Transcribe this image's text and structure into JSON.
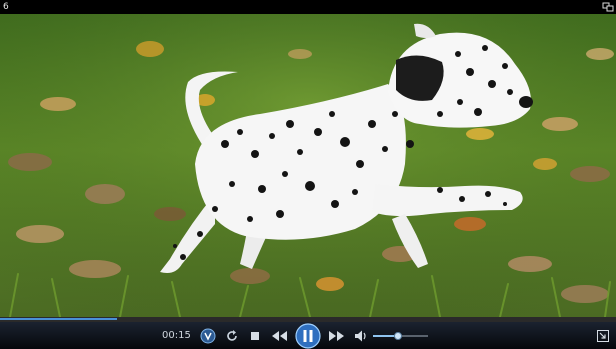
{
  "window": {
    "title": "6"
  },
  "playback": {
    "time_display": "00:15",
    "progress_fraction": 0.19,
    "volume_fraction": 0.45,
    "state": "playing"
  },
  "icons": {
    "restore": "restore-window-icon",
    "switch_library": "switch-to-library-icon",
    "shuffle": "shuffle-icon",
    "repeat": "repeat-icon",
    "stop": "stop-icon",
    "previous": "previous-icon",
    "play_pause": "pause-icon",
    "next": "next-icon",
    "mute": "volume-icon",
    "exit_fullscreen": "exit-fullscreen-icon"
  },
  "colors": {
    "accent": "#4a90d9",
    "play_button": "#2f6fbf",
    "control_bar": "#0b0f16"
  }
}
